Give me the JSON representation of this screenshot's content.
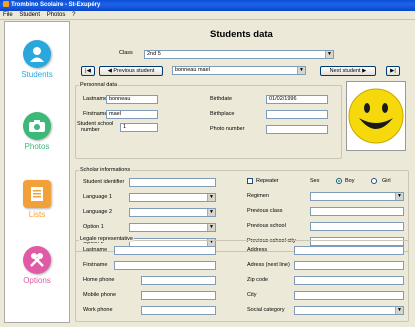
{
  "window": {
    "title": "Trombino Scolaire - St-Exupéry"
  },
  "menu": {
    "file": "File",
    "student": "Student",
    "photos": "Photos",
    "help": "?"
  },
  "sidebar": {
    "items": [
      {
        "label": "Students",
        "color": "#2aa7dc"
      },
      {
        "label": "Photos",
        "color": "#3cb878"
      },
      {
        "label": "Lists",
        "color": "#f2a03a"
      },
      {
        "label": "Options",
        "color": "#e05aa6"
      }
    ]
  },
  "main": {
    "heading": "Students data",
    "class_label": "Class",
    "class_value": "2nd 5",
    "prev_button": "Previous student",
    "student_combo": "bonneau mael",
    "next_button": "Next student",
    "personal": {
      "title": "Personnal data",
      "lastname_label": "Lastname",
      "lastname_value": "bonneau",
      "firstname_label": "Firstname",
      "firstname_value": "mael",
      "number_label_1": "Student school",
      "number_label_2": "number",
      "number_value": "1",
      "birthdate_label": "Birthdate",
      "birthdate_value": "01/02/1996",
      "birthplace_label": "Birthplace",
      "photo_number_label": "Photo number"
    },
    "scholar": {
      "title": "Scholar informations",
      "student_id_label": "Student identifier",
      "language1_label": "Language 1",
      "language2_label": "Language 2",
      "option1_label": "Option 1",
      "option2_label": "Option 2",
      "repeater_label": "Repeater",
      "sex_label": "Sex",
      "boy_label": "Boy",
      "girl_label": "Girl",
      "regimen_label": "Regimen",
      "prev_class_label": "Previous class",
      "prev_school_label": "Previous school",
      "prev_city_label": "Previous school city"
    },
    "legal": {
      "title": "Legale representative",
      "lastname_label": "Lastname",
      "firstname_label": "Firstname",
      "home_phone_label": "Home phone",
      "mobile_phone_label": "Mobile phone",
      "work_phone_label": "Work phone",
      "address_label": "Address",
      "address_next_label": "Adress (next line)",
      "zip_label": "Zip code",
      "city_label": "City",
      "social_label": "Social category"
    }
  }
}
